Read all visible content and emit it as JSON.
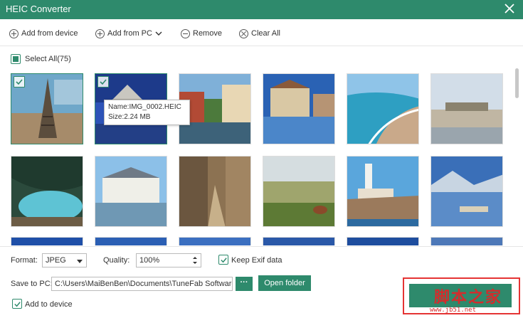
{
  "window": {
    "title": "HEIC Converter"
  },
  "toolbar": {
    "add_from_device": "Add from device",
    "add_from_pc": "Add from PC",
    "remove": "Remove",
    "clear_all": "Clear All"
  },
  "selection": {
    "label": "Select All(75)"
  },
  "tooltip": {
    "name": "Name:IMG_0002.HEIC",
    "size": "Size:2.24 MB"
  },
  "settings": {
    "format_label": "Format:",
    "format_value": "JPEG",
    "quality_label": "Quality:",
    "quality_value": "100%",
    "keep_exif": "Keep Exif data",
    "save_to_label": "Save to PC:",
    "save_path": "C:\\Users\\MaiBenBen\\Documents\\TuneFab Software",
    "browse": "···",
    "open_folder": "Open folder",
    "add_to_device": "Add to device"
  },
  "watermark": {
    "line1": "脚本之家",
    "line2": "www.jb51.net"
  },
  "colors": {
    "accent": "#2e8a6c",
    "highlight": "#e53434"
  }
}
